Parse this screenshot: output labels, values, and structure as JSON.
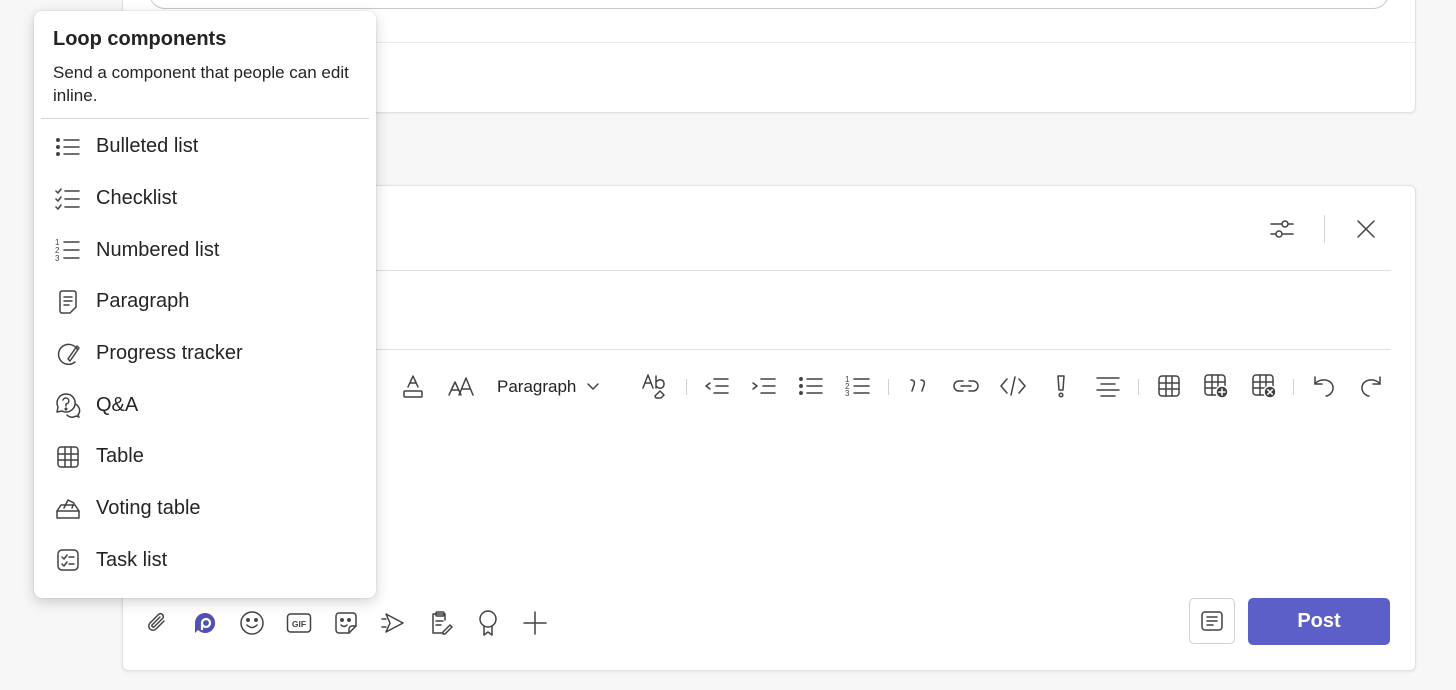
{
  "loop_popup": {
    "title": "Loop components",
    "description": "Send a component that people can edit inline.",
    "items": [
      {
        "label": "Bulleted list",
        "icon": "bulleted-list-icon"
      },
      {
        "label": "Checklist",
        "icon": "checklist-icon"
      },
      {
        "label": "Numbered list",
        "icon": "numbered-list-icon"
      },
      {
        "label": "Paragraph",
        "icon": "paragraph-icon"
      },
      {
        "label": "Progress tracker",
        "icon": "progress-tracker-icon"
      },
      {
        "label": "Q&A",
        "icon": "qna-icon"
      },
      {
        "label": "Table",
        "icon": "table-icon"
      },
      {
        "label": "Voting table",
        "icon": "voting-table-icon"
      },
      {
        "label": "Task list",
        "icon": "task-list-icon"
      }
    ]
  },
  "format_toolbar": {
    "paragraph_style": "Paragraph"
  },
  "compose": {
    "post_label": "Post",
    "accent_color": "#5b5fc7"
  }
}
